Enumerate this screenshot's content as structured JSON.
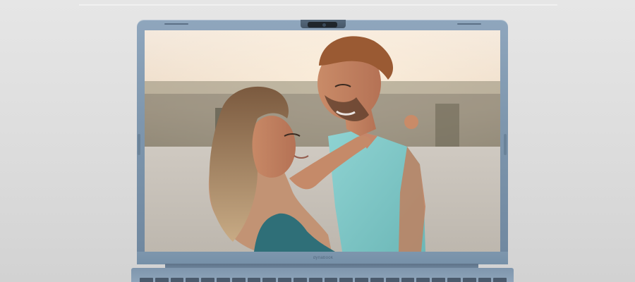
{
  "scene": {
    "subject": "laptop",
    "screen_content": "photo",
    "colors": {
      "lid": "#7f97ae",
      "webcam": "#1f252b",
      "background": "#dcdcdc",
      "shirt": "#7fc6c6",
      "dress": "#2f6f78"
    }
  },
  "laptop": {
    "brand": "dynabook"
  }
}
